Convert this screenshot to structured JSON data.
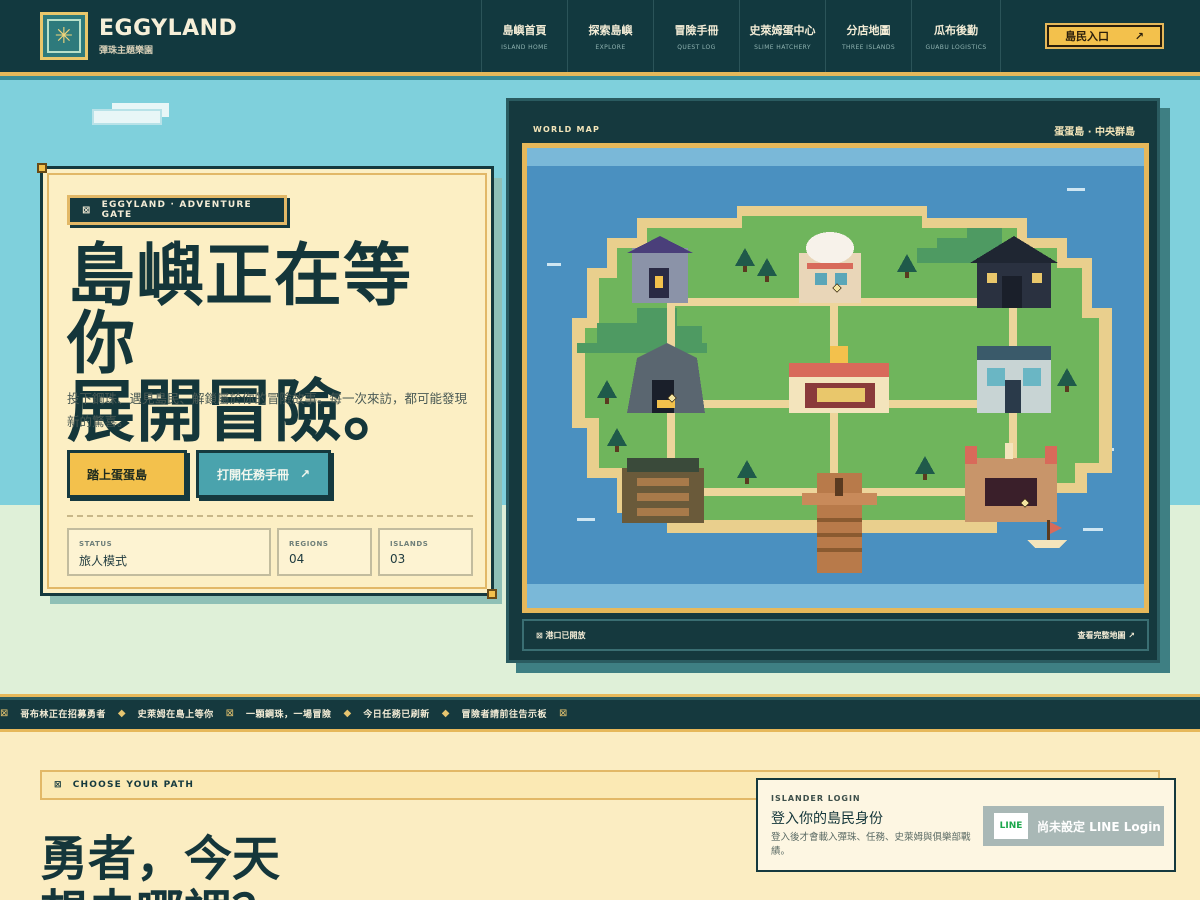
{
  "brand": {
    "name": "EGGYLAND",
    "subtitle": "彈珠主題樂園",
    "logo_icon": "sparkle-icon"
  },
  "nav": [
    {
      "zh": "島嶼首頁",
      "en": "ISLAND HOME"
    },
    {
      "zh": "探索島嶼",
      "en": "EXPLORE"
    },
    {
      "zh": "冒險手冊",
      "en": "QUEST LOG"
    },
    {
      "zh": "史萊姆蛋中心",
      "en": "SLIME HATCHERY"
    },
    {
      "zh": "分店地圖",
      "en": "THREE ISLANDS"
    },
    {
      "zh": "瓜布後勤",
      "en": "GUABU LOGISTICS"
    }
  ],
  "header": {
    "login_label": "島民入口",
    "login_arrow": "↗"
  },
  "hero": {
    "kicker": "EGGYLAND · ADVENTURE GATE",
    "title_line1": "島嶼正在等你",
    "title_line2": "展開冒險。",
    "description": "投下鋼珠、遇見島民、解鎖屬於你的冒險故事。每一次來訪，都可能發現新的驚喜。",
    "primary_button": "踏上蛋蛋島",
    "secondary_button": "打開任務手冊",
    "secondary_arrow": "↗",
    "stats": [
      {
        "label": "STATUS",
        "value": "旅人模式"
      },
      {
        "label": "REGIONS",
        "value": "04"
      },
      {
        "label": "ISLANDS",
        "value": "03"
      }
    ]
  },
  "world_map": {
    "label": "WORLD MAP",
    "region": "蛋蛋島 · 中央群島",
    "footer_status": "港口已開放",
    "footer_link": "查看完整地圖 ↗"
  },
  "ticker": [
    "哥布林正在招募勇者",
    "史萊姆在島上等你",
    "一顆鋼珠，一場冒險",
    "今日任務已刷新",
    "冒險者請前往告示板"
  ],
  "choose_path": {
    "label": "CHOOSE YOUR PATH",
    "title_line1": "勇者，今天",
    "title_line2": "想去哪裡？"
  },
  "islander_login": {
    "kicker": "ISLANDER LOGIN",
    "title": "登入你的島民身份",
    "description": "登入後才會載入彈珠、任務、史萊姆與俱樂部戰績。",
    "line_badge": "LINE",
    "line_button": "尚未設定 LINE Login"
  },
  "colors": {
    "navy": "#15393e",
    "gold": "#f3c14c",
    "teal": "#4aa3ad",
    "sky": "#7fd0dc",
    "cream": "#fcefc4"
  }
}
